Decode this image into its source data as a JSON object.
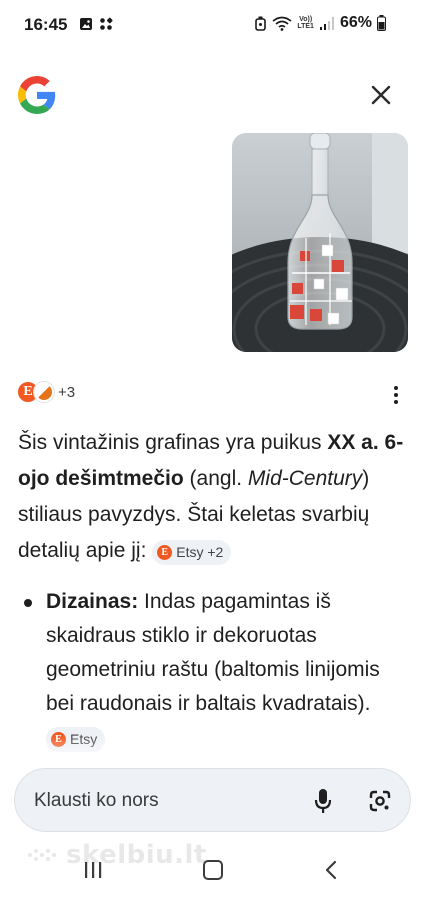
{
  "status_bar": {
    "time": "16:45",
    "battery": "66%",
    "volte_line1": "Vo))",
    "volte_line2": "LTE1"
  },
  "header": {
    "logo_icon": "google-g-icon",
    "close_icon": "close-icon"
  },
  "result_image": {
    "description_icon": "glass-decanter-photo"
  },
  "sources": {
    "first_letter": "E",
    "count_label": "+3",
    "more_icon": "more-vert-icon"
  },
  "answer": {
    "p1": "Šis vintažinis grafinas yra puikus ",
    "p1_bold": "XX a. 6-ojo dešimtmečio",
    "p2": " (angl. ",
    "p2_italic": "Mid-Century",
    "p3": ") stiliaus pavyzdys. Štai keletas svarbių detalių apie jį: ",
    "chip1_letter": "E",
    "chip1_label": "Etsy +2"
  },
  "bullet": {
    "label": "Dizainas:",
    "text": " Indas pagamintas iš skaidraus stiklo ir dekoruotas geometriniu raštu (baltomis linijomis bei raudonais ir baltais kvadratais). ",
    "chip_letter": "E",
    "chip_label": "Etsy"
  },
  "search": {
    "placeholder": "Klausti ko nors",
    "mic_icon": "mic-icon",
    "lens_icon": "google-lens-icon"
  },
  "watermark": {
    "text": "skelbiu.lt"
  },
  "nav": {
    "recents_icon": "recents-icon",
    "home_icon": "home-icon",
    "back_icon": "back-icon"
  },
  "colors": {
    "etsy_orange": "#f05a22",
    "search_bg": "#eef1f5",
    "text": "#1f1f1f"
  }
}
